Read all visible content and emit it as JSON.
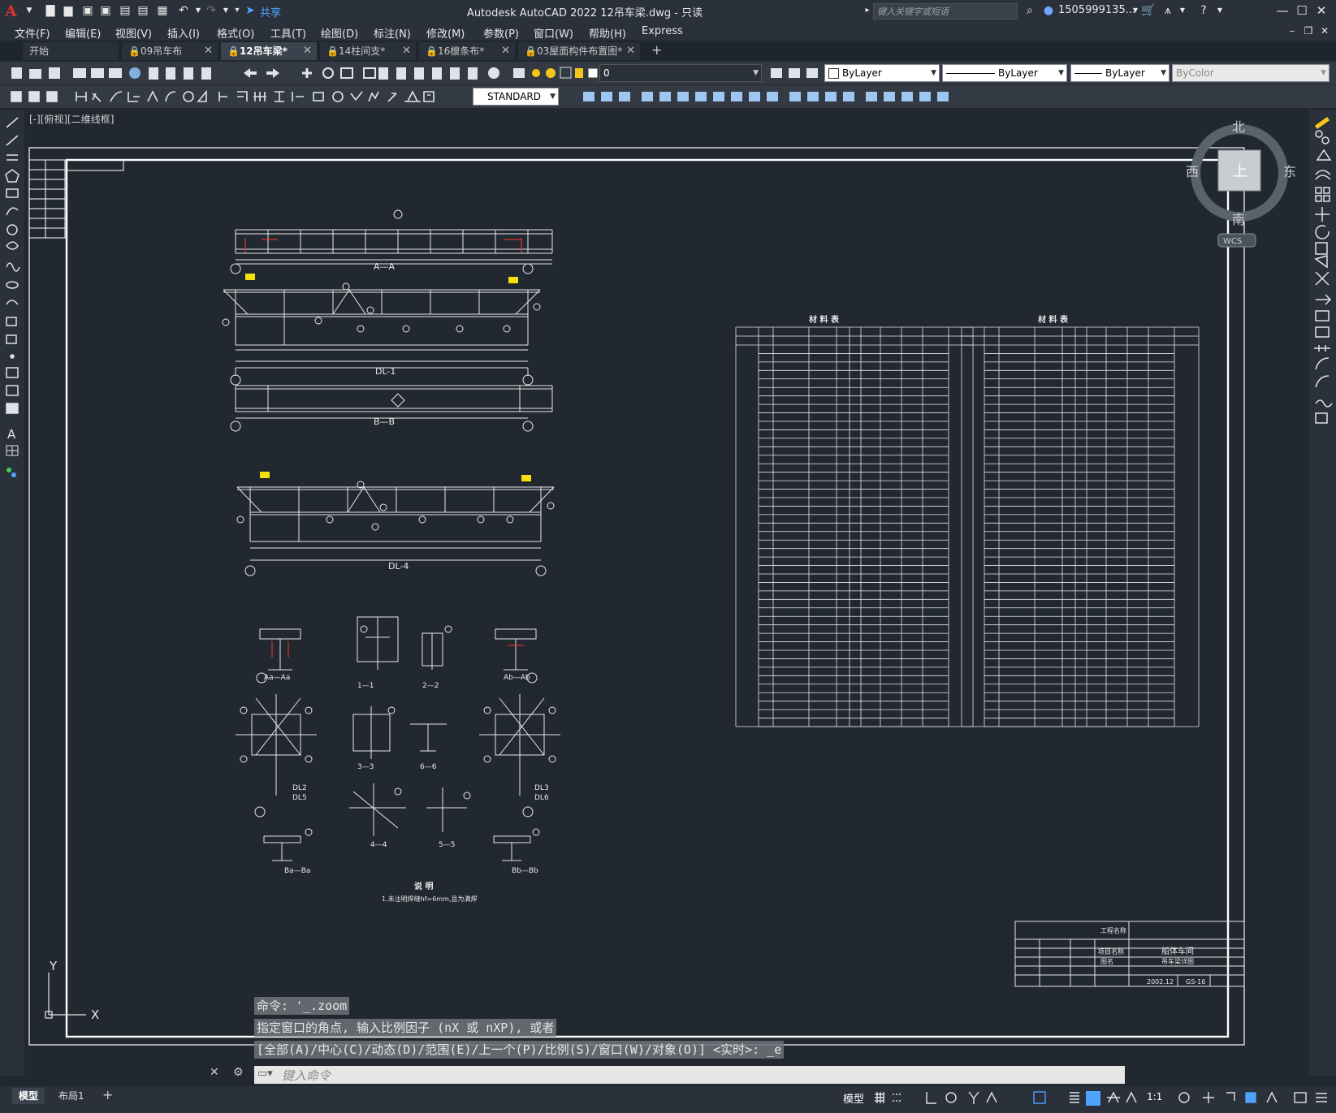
{
  "titlebar": {
    "app_title": "Autodesk AutoCAD 2022    12吊车梁.dwg - 只读",
    "share": "共享",
    "search_placeholder": "键入关键字或短语",
    "user": "1505999135...",
    "logo": "A"
  },
  "menu": [
    "文件(F)",
    "编辑(E)",
    "视图(V)",
    "插入(I)",
    "格式(O)",
    "工具(T)",
    "绘图(D)",
    "标注(N)",
    "修改(M)",
    "参数(P)",
    "窗口(W)",
    "帮助(H)",
    "Express"
  ],
  "tabs": [
    {
      "label": "开始",
      "active": false
    },
    {
      "label": "09吊车布",
      "active": false
    },
    {
      "label": "12吊车梁*",
      "active": true
    },
    {
      "label": "14柱间支*",
      "active": false
    },
    {
      "label": "16檩条布*",
      "active": false
    },
    {
      "label": "03屋面构件布置图*",
      "active": false
    }
  ],
  "toolbar": {
    "layer": "0",
    "color": "ByLayer",
    "linetype": "ByLayer",
    "lineweight": "ByLayer",
    "plotstyle": "ByColor",
    "textstyle": "STANDARD"
  },
  "view_label": "[-][俯视][二维线框]",
  "viewcube": {
    "north": "北",
    "south": "南",
    "east": "东",
    "west": "西",
    "top": "上",
    "wcs": "WCS"
  },
  "drawing": {
    "titles": [
      "A—A",
      "DL-1",
      "B—B",
      "DL-4",
      "Aa—Aa",
      "1—1",
      "2—2",
      "Ab—Ab",
      "3—3",
      "6—6",
      "DL2",
      "DL5",
      "DL3",
      "DL6",
      "4—4",
      "5—5",
      "Ba—Ba",
      "Bb—Bb"
    ],
    "notes_title": "说  明",
    "notes_text": "1.未注明焊缝hf=6mm,且为满焊",
    "table1_title": "材    料    表",
    "table2_title": "材    料    表",
    "tb_project": "船体车间",
    "tb_drawing": "吊车梁详图",
    "tb_number": "GS-16",
    "tb_date": "2002.12",
    "tb_headers": [
      "工程名称",
      "项目名称",
      "图名"
    ]
  },
  "command": {
    "line1": "命令: '_.zoom",
    "line2": "指定窗口的角点, 输入比例因子 (nX 或 nXP), 或者",
    "line3": "[全部(A)/中心(C)/动态(D)/范围(E)/上一个(P)/比例(S)/窗口(W)/对象(O)] <实时>: _e",
    "placeholder": "键入命令"
  },
  "status": {
    "tabs": [
      "模型",
      "布局1"
    ],
    "model": "模型",
    "scale": "1:1"
  }
}
